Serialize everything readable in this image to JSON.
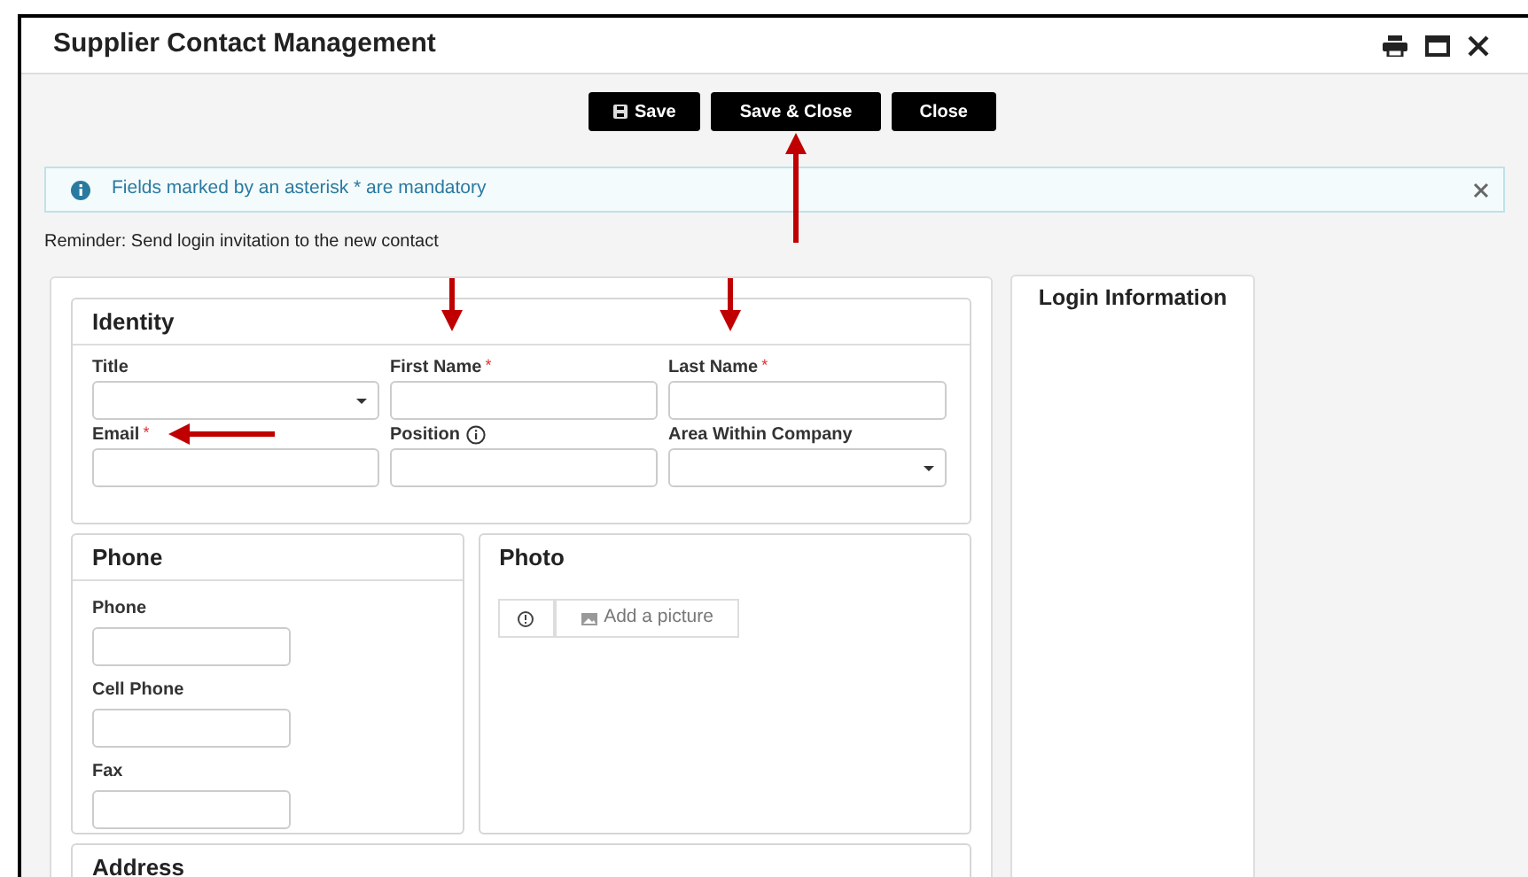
{
  "window": {
    "title": "Supplier Contact Management"
  },
  "toolbar": {
    "buttons": [
      {
        "label": "Save",
        "kind": "save"
      },
      {
        "label": "Save & Close",
        "kind": "plain",
        "annotation": {
          "kind": "arrow_up"
        }
      },
      {
        "label": "Close",
        "kind": "plain"
      }
    ]
  },
  "notice": {
    "text": "Fields marked by an asterisk * are mandatory"
  },
  "reminder": "Reminder: Send login invitation to the new contact",
  "identity": {
    "title": "Identity",
    "fields": [
      {
        "label": "Title",
        "kind": "select",
        "info": false
      },
      {
        "label": "First Name",
        "asterisk": "*",
        "kind": "text",
        "info": false,
        "annotation": {
          "kind": "arrow_down"
        }
      },
      {
        "label": "Last Name",
        "asterisk": "*",
        "kind": "text",
        "info": false,
        "annotation": {
          "kind": "arrow_down"
        }
      },
      {
        "label": "Email",
        "asterisk": "*",
        "kind": "text",
        "info": false,
        "annotation": {
          "kind": "arrow_left"
        }
      },
      {
        "label": "Position",
        "kind": "text",
        "info": true
      },
      {
        "label": "Area Within Company",
        "kind": "select",
        "info": false
      }
    ]
  },
  "phone": {
    "title": "Phone",
    "fields": [
      {
        "label": "Phone"
      },
      {
        "label": "Cell Phone"
      },
      {
        "label": "Fax"
      }
    ]
  },
  "photo": {
    "title": "Photo",
    "add_button": "Add a picture"
  },
  "login": {
    "title": "Login Information"
  },
  "address": {
    "title": "Address"
  }
}
